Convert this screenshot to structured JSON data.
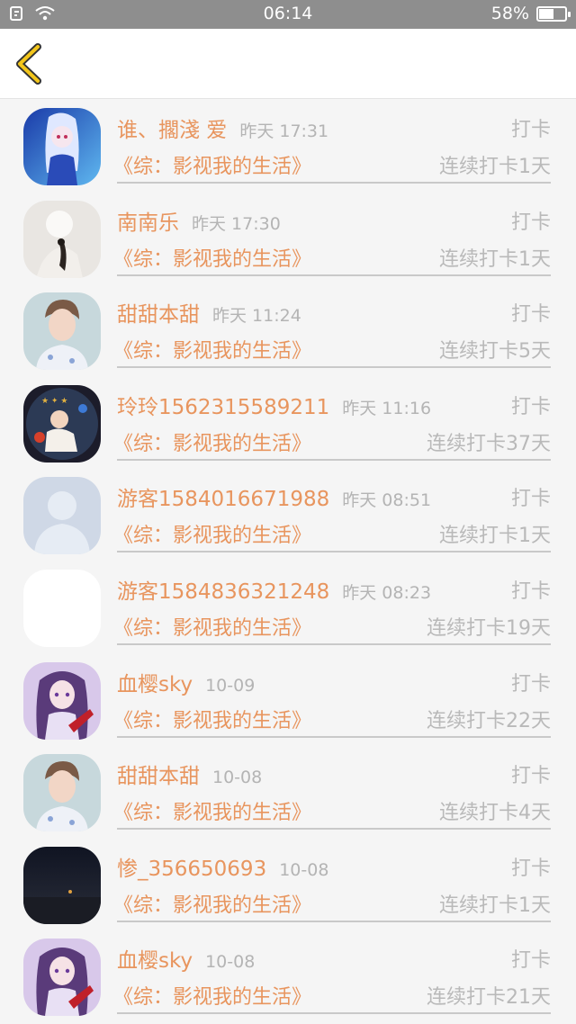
{
  "status_bar": {
    "time": "06:14",
    "battery_text": "58%",
    "battery_level": 0.58,
    "icons": [
      "notification-icon",
      "wifi-icon",
      "battery-icon"
    ]
  },
  "nav": {
    "back_icon": "chevron-left-icon"
  },
  "colors": {
    "accent": "#e8955e",
    "muted": "#b9b9b9",
    "divider": "#c9c9c9"
  },
  "records": [
    {
      "name": "谁、擱淺 爱",
      "time": "昨天 17:31",
      "action": "打卡",
      "book": "《综：影视我的生活》",
      "streak": "连续打卡1天",
      "avatar": "anime-girl-blue"
    },
    {
      "name": "南南乐",
      "time": "昨天 17:30",
      "action": "打卡",
      "book": "《综：影视我的生活》",
      "streak": "连续打卡1天",
      "avatar": "white-figure"
    },
    {
      "name": "甜甜本甜",
      "time": "昨天 11:24",
      "action": "打卡",
      "book": "《综：影视我的生活》",
      "streak": "连续打卡5天",
      "avatar": "young-man"
    },
    {
      "name": "玲玲1562315589211",
      "time": "昨天 11:16",
      "action": "打卡",
      "book": "《综：影视我的生活》",
      "streak": "连续打卡37天",
      "avatar": "baby-photo"
    },
    {
      "name": "游客1584016671988",
      "time": "昨天 08:51",
      "action": "打卡",
      "book": "《综：影视我的生活》",
      "streak": "连续打卡1天",
      "avatar": "default-silhouette"
    },
    {
      "name": "游客1584836321248",
      "time": "昨天 08:23",
      "action": "打卡",
      "book": "《综：影视我的生活》",
      "streak": "连续打卡19天",
      "avatar": "blank"
    },
    {
      "name": "血樱sky",
      "time": "10-09",
      "action": "打卡",
      "book": "《综：影视我的生活》",
      "streak": "连续打卡22天",
      "avatar": "anime-girl-purple"
    },
    {
      "name": "甜甜本甜",
      "time": "10-08",
      "action": "打卡",
      "book": "《综：影视我的生活》",
      "streak": "连续打卡4天",
      "avatar": "young-man"
    },
    {
      "name": "惨_356650693",
      "time": "10-08",
      "action": "打卡",
      "book": "《综：影视我的生活》",
      "streak": "连续打卡1天",
      "avatar": "night-sky"
    },
    {
      "name": "血樱sky",
      "time": "10-08",
      "action": "打卡",
      "book": "《综：影视我的生活》",
      "streak": "连续打卡21天",
      "avatar": "anime-girl-purple"
    }
  ]
}
